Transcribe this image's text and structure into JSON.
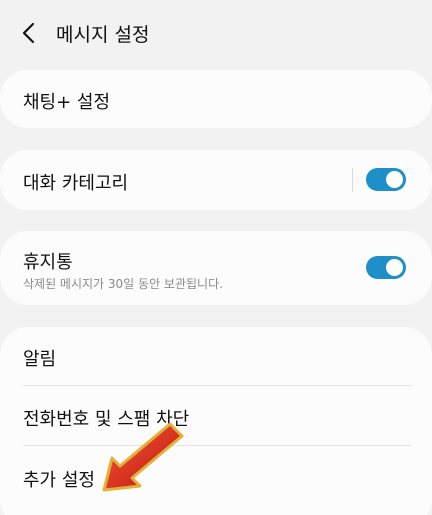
{
  "header": {
    "back_icon": "chevron-left-icon",
    "title": "메시지 설정"
  },
  "settings": {
    "chat_plus": {
      "label": "채팅+ 설정"
    },
    "conversation_categories": {
      "label": "대화 카테고리",
      "toggle_on": true
    },
    "trash": {
      "label": "휴지통",
      "description": "삭제된 메시지가 30일 동안 보관됩니다.",
      "toggle_on": true
    },
    "list": [
      {
        "label": "알림"
      },
      {
        "label": "전화번호 및 스팸 차단"
      },
      {
        "label": "추가 설정"
      }
    ]
  },
  "colors": {
    "toggle_accent": "#1e8fc9",
    "annotation_arrow": "#d8231a"
  }
}
